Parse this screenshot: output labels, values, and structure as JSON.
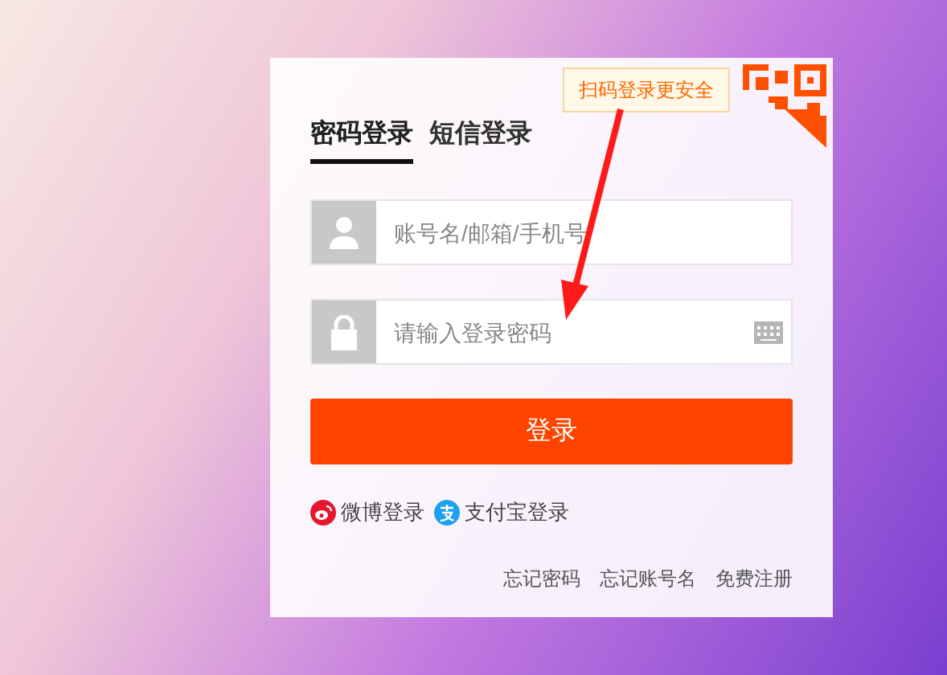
{
  "qr_tip": "扫码登录更安全",
  "tabs": [
    {
      "label": "密码登录",
      "selected": true
    },
    {
      "label": "短信登录",
      "selected": false
    }
  ],
  "fields": [
    {
      "kind": "account",
      "placeholder": "账号名/邮箱/手机号"
    },
    {
      "kind": "password",
      "placeholder": "请输入登录密码"
    }
  ],
  "submit": "登录",
  "social_logins": [
    {
      "kind": "weibo",
      "label": "微博登录"
    },
    {
      "kind": "alipay",
      "label": "支付宝登录"
    }
  ],
  "links": [
    "忘记密码",
    "忘记账号名",
    "免费注册"
  ]
}
